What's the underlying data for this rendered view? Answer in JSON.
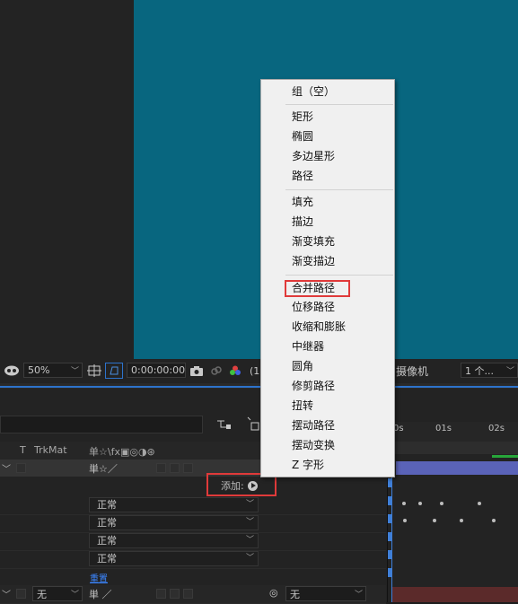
{
  "viewer": {
    "zoom": "50%",
    "timecode": "0:00:00:00",
    "paren_fragment": "(1",
    "camera": "摄像机",
    "views": "1 个..."
  },
  "timeline": {
    "columns": {
      "t": "T",
      "trkmat": "TrkMat",
      "switches": "单☆\\fx▣◎◑⊛"
    },
    "ruler": [
      "0s",
      "01s",
      "02s"
    ],
    "add_label": "添加:",
    "modes": [
      "正常",
      "正常",
      "正常",
      "正常"
    ],
    "reset": "重置",
    "bottom_row": {
      "trkmat": "无",
      "parent": "无"
    }
  },
  "context_menu": {
    "items": [
      "组（空）",
      "矩形",
      "椭圆",
      "多边星形",
      "路径",
      "填充",
      "描边",
      "渐变填充",
      "渐变描边",
      "合并路径",
      "位移路径",
      "收缩和膨胀",
      "中继器",
      "圆角",
      "修剪路径",
      "扭转",
      "摆动路径",
      "摆动变换",
      "Z 字形"
    ],
    "highlighted": "合并路径"
  },
  "colors": {
    "comp_bg": "#08667f",
    "highlight_box": "#e03a3a",
    "layer_bar": "#5a63b8",
    "link": "#3b86ff"
  }
}
